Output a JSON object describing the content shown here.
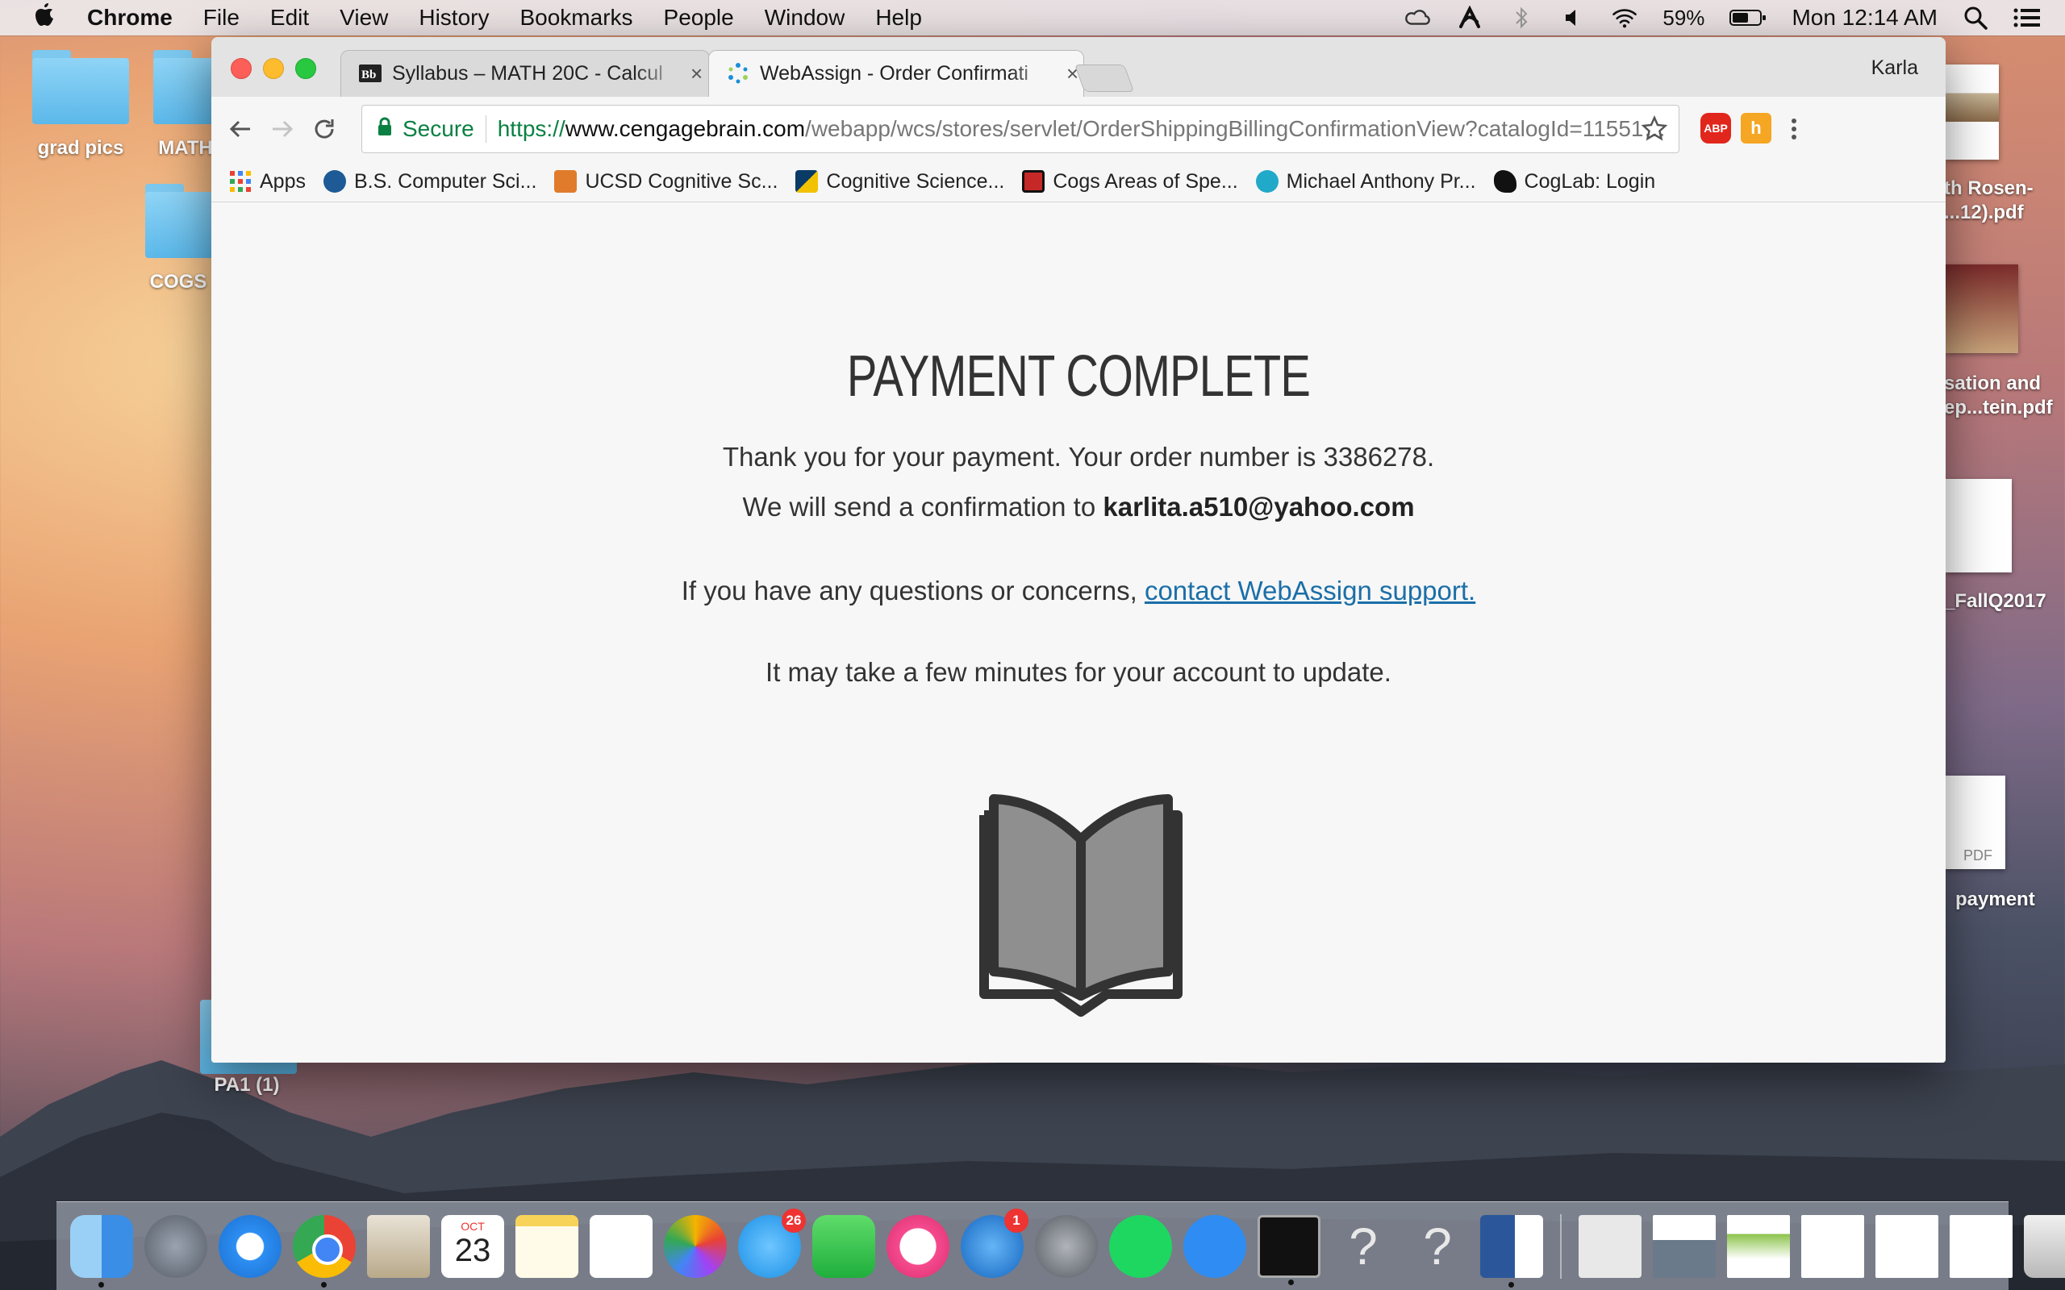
{
  "menubar": {
    "app_name": "Chrome",
    "menus": [
      "File",
      "Edit",
      "View",
      "History",
      "Bookmarks",
      "People",
      "Window",
      "Help"
    ],
    "battery": "59%",
    "clock": "Mon 12:14 AM"
  },
  "desktop": {
    "icons": [
      "grad pics",
      "MATH",
      "COGS",
      "PA1 (1)"
    ],
    "right_labels": [
      "th Rosen-",
      "...12).pdf",
      "sation and",
      "ep...tein.pdf",
      "_FallQ2017",
      "payment"
    ],
    "pdf_label": "PDF"
  },
  "browser": {
    "profile": "Karla",
    "tabs": [
      {
        "title": "Syllabus – MATH 20C - Calcul",
        "favicon": "blackboard-icon",
        "active": false
      },
      {
        "title": "WebAssign - Order Confirmati",
        "favicon": "webassign-icon",
        "active": true
      }
    ],
    "omnibox": {
      "secure_label": "Secure",
      "scheme": "https://",
      "host": "www.cengagebrain.com",
      "path": "/webapp/wcs/stores/servlet/OrderShippingBillingConfirmationView?catalogId=11551…"
    },
    "extensions": [
      "ABP",
      "h"
    ],
    "bookmarks": [
      {
        "label": "Apps",
        "icon": "apps-grid-icon",
        "color": "#e44d26"
      },
      {
        "label": "B.S. Computer Sci...",
        "icon": "ucsd-icon",
        "color": "#1e5a96"
      },
      {
        "label": "UCSD Cognitive Sc...",
        "icon": "cube-icon",
        "color": "#e07b2b"
      },
      {
        "label": "Cognitive Science...",
        "icon": "ucsd-flag-icon",
        "color": "#0a3a66"
      },
      {
        "label": "Cogs Areas of Spe...",
        "icon": "site-icon",
        "color": "#c62828"
      },
      {
        "label": "Michael Anthony Pr...",
        "icon": "circle-a-icon",
        "color": "#21a9c9"
      },
      {
        "label": "CogLab: Login",
        "icon": "coglab-icon",
        "color": "#111111"
      }
    ]
  },
  "page": {
    "heading": "PAYMENT COMPLETE",
    "thanks": "Thank you for your payment. Your order number is 3386278.",
    "confirm_prefix": "We will send a confirmation to ",
    "email": "karlita.a510@yahoo.com",
    "questions_prefix": "If you have any questions or concerns, ",
    "support_link": "contact WebAssign support.",
    "update_note": "It may take a few minutes for your account to update."
  },
  "dock": {
    "calendar_month": "OCT",
    "calendar_day": "23",
    "messages_badge": "26",
    "appstore_badge": "1",
    "help_glyph": "?"
  }
}
